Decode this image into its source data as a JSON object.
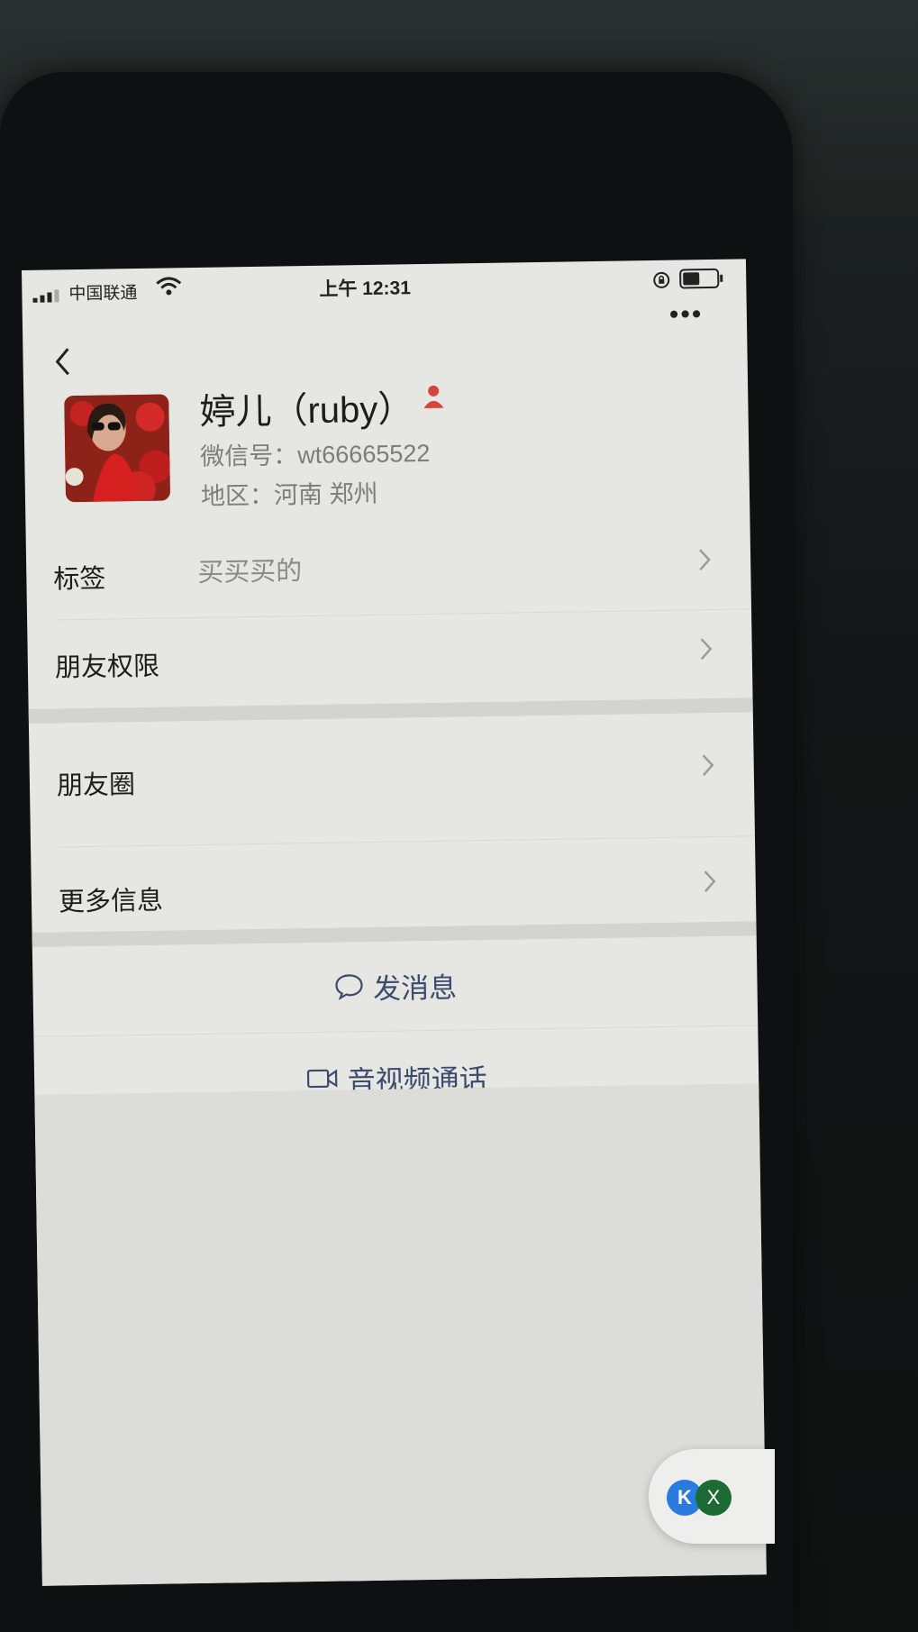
{
  "status_bar": {
    "carrier": "中国联通",
    "time": "上午 12:31"
  },
  "header": {
    "more_glyph": "•••"
  },
  "profile": {
    "name": "婷儿（ruby）",
    "wechat_id": "微信号：wt66665522",
    "region": "地区：河南 郑州"
  },
  "rows": {
    "tag_label": "标签",
    "tag_value": "买买买的",
    "permission_label": "朋友权限",
    "moments_label": "朋友圈",
    "more_info_label": "更多信息"
  },
  "actions": {
    "send_message": "发消息",
    "video_call": "音视频通话"
  },
  "floating": {
    "k_badge": "K",
    "x_badge": "X"
  },
  "colors": {
    "action_text": "#3c4a6e",
    "badge_red": "#d6453b"
  }
}
